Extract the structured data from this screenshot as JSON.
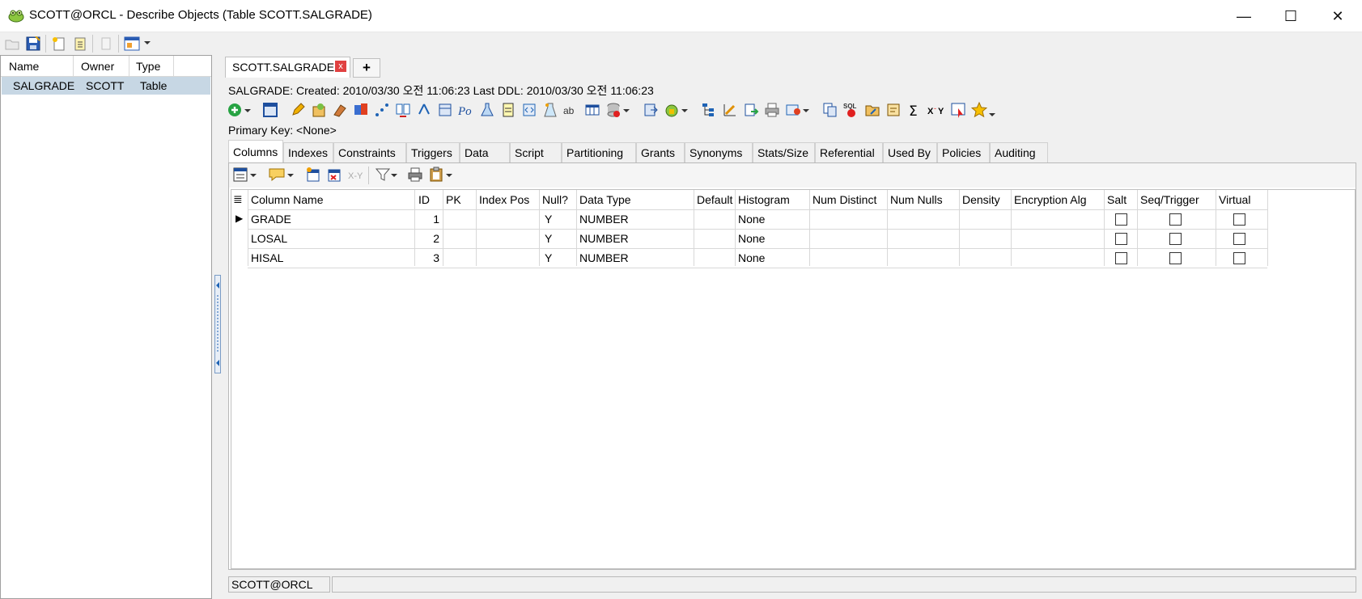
{
  "window": {
    "title": "SCOTT@ORCL - Describe Objects (Table SCOTT.SALGRADE)",
    "minimize_glyph": "—",
    "maximize_glyph": "☐",
    "close_glyph": "✕"
  },
  "left_panel": {
    "columns": [
      "Name",
      "Owner",
      "Type"
    ],
    "rows": [
      {
        "name": "SALGRADE",
        "owner": "SCOTT",
        "type": "Table"
      }
    ]
  },
  "doc_tab": {
    "label": "SCOTT.SALGRADE",
    "close_glyph": "x",
    "add_glyph": "+"
  },
  "object_info": {
    "line": "SALGRADE:   Created: 2010/03/30 오전 11:06:23   Last DDL: 2010/03/30 오전 11:06:23",
    "primary_key": "Primary Key:  <None>"
  },
  "sub_tabs": [
    "Columns",
    "Indexes",
    "Constraints",
    "Triggers",
    "Data",
    "Script",
    "Partitioning",
    "Grants",
    "Synonyms",
    "Stats/Size",
    "Referential",
    "Used By",
    "Policies",
    "Auditing"
  ],
  "grid": {
    "columns": [
      "Column Name",
      "ID",
      "PK",
      "Index Pos",
      "Null?",
      "Data Type",
      "Default",
      "Histogram",
      "Num Distinct",
      "Num Nulls",
      "Density",
      "Encryption Alg",
      "Salt",
      "Seq/Trigger",
      "Virtual"
    ],
    "rows": [
      {
        "column_name": "GRADE",
        "id": "1",
        "pk": "",
        "index_pos": "",
        "null": "Y",
        "data_type": "NUMBER",
        "default": "",
        "histogram": "None",
        "num_distinct": "",
        "num_nulls": "",
        "density": "",
        "encryption": "",
        "salt": false,
        "seq": false,
        "virtual": false
      },
      {
        "column_name": "LOSAL",
        "id": "2",
        "pk": "",
        "index_pos": "",
        "null": "Y",
        "data_type": "NUMBER",
        "default": "",
        "histogram": "None",
        "num_distinct": "",
        "num_nulls": "",
        "density": "",
        "encryption": "",
        "salt": false,
        "seq": false,
        "virtual": false
      },
      {
        "column_name": "HISAL",
        "id": "3",
        "pk": "",
        "index_pos": "",
        "null": "Y",
        "data_type": "NUMBER",
        "default": "",
        "histogram": "None",
        "num_distinct": "",
        "num_nulls": "",
        "density": "",
        "encryption": "",
        "salt": false,
        "seq": false,
        "virtual": false
      }
    ],
    "current_row_marker": "▶",
    "row_selector_glyph": "≣"
  },
  "status_bar": {
    "connection": "SCOTT@ORCL",
    "message": ""
  },
  "colors": {
    "selection": "#c7d7e4",
    "accent_blue": "#1e63b5",
    "close_red": "#e04040"
  }
}
